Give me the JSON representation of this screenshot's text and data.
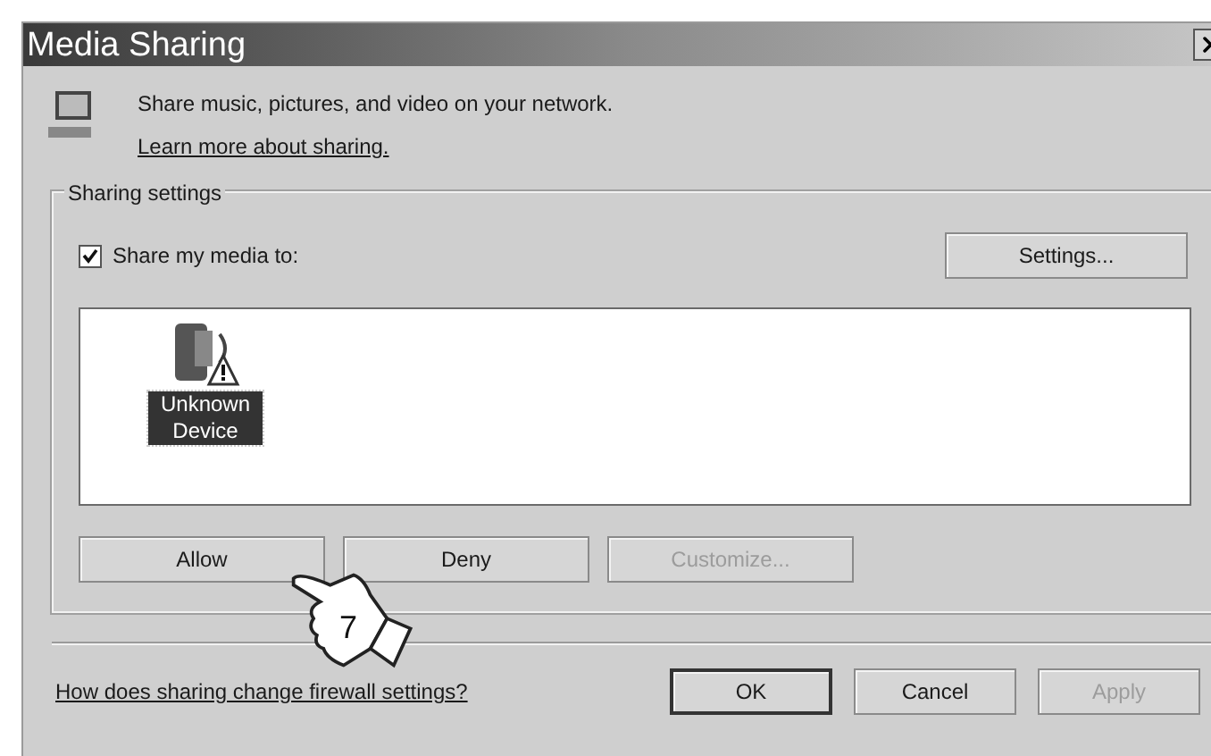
{
  "window": {
    "title": "Media Sharing"
  },
  "intro": {
    "text": "Share music, pictures, and video on your network.",
    "link": "Learn more about sharing."
  },
  "group": {
    "legend": "Sharing settings",
    "share_checkbox": {
      "label": "Share my media to:",
      "checked": true
    },
    "settings_button": {
      "label": "Settings...",
      "disabled": false
    },
    "devices": [
      {
        "label": "Unknown Device",
        "selected": true
      }
    ],
    "buttons": [
      {
        "label": "Allow",
        "disabled": false
      },
      {
        "label": "Deny",
        "disabled": false
      },
      {
        "label": "Customize...",
        "disabled": true
      }
    ]
  },
  "callout": {
    "number": "7"
  },
  "footer": {
    "link": "How does sharing change firewall settings?",
    "buttons": [
      {
        "label": "OK",
        "disabled": false,
        "default": true
      },
      {
        "label": "Cancel",
        "disabled": false,
        "default": false
      },
      {
        "label": "Apply",
        "disabled": true,
        "default": false
      }
    ]
  }
}
